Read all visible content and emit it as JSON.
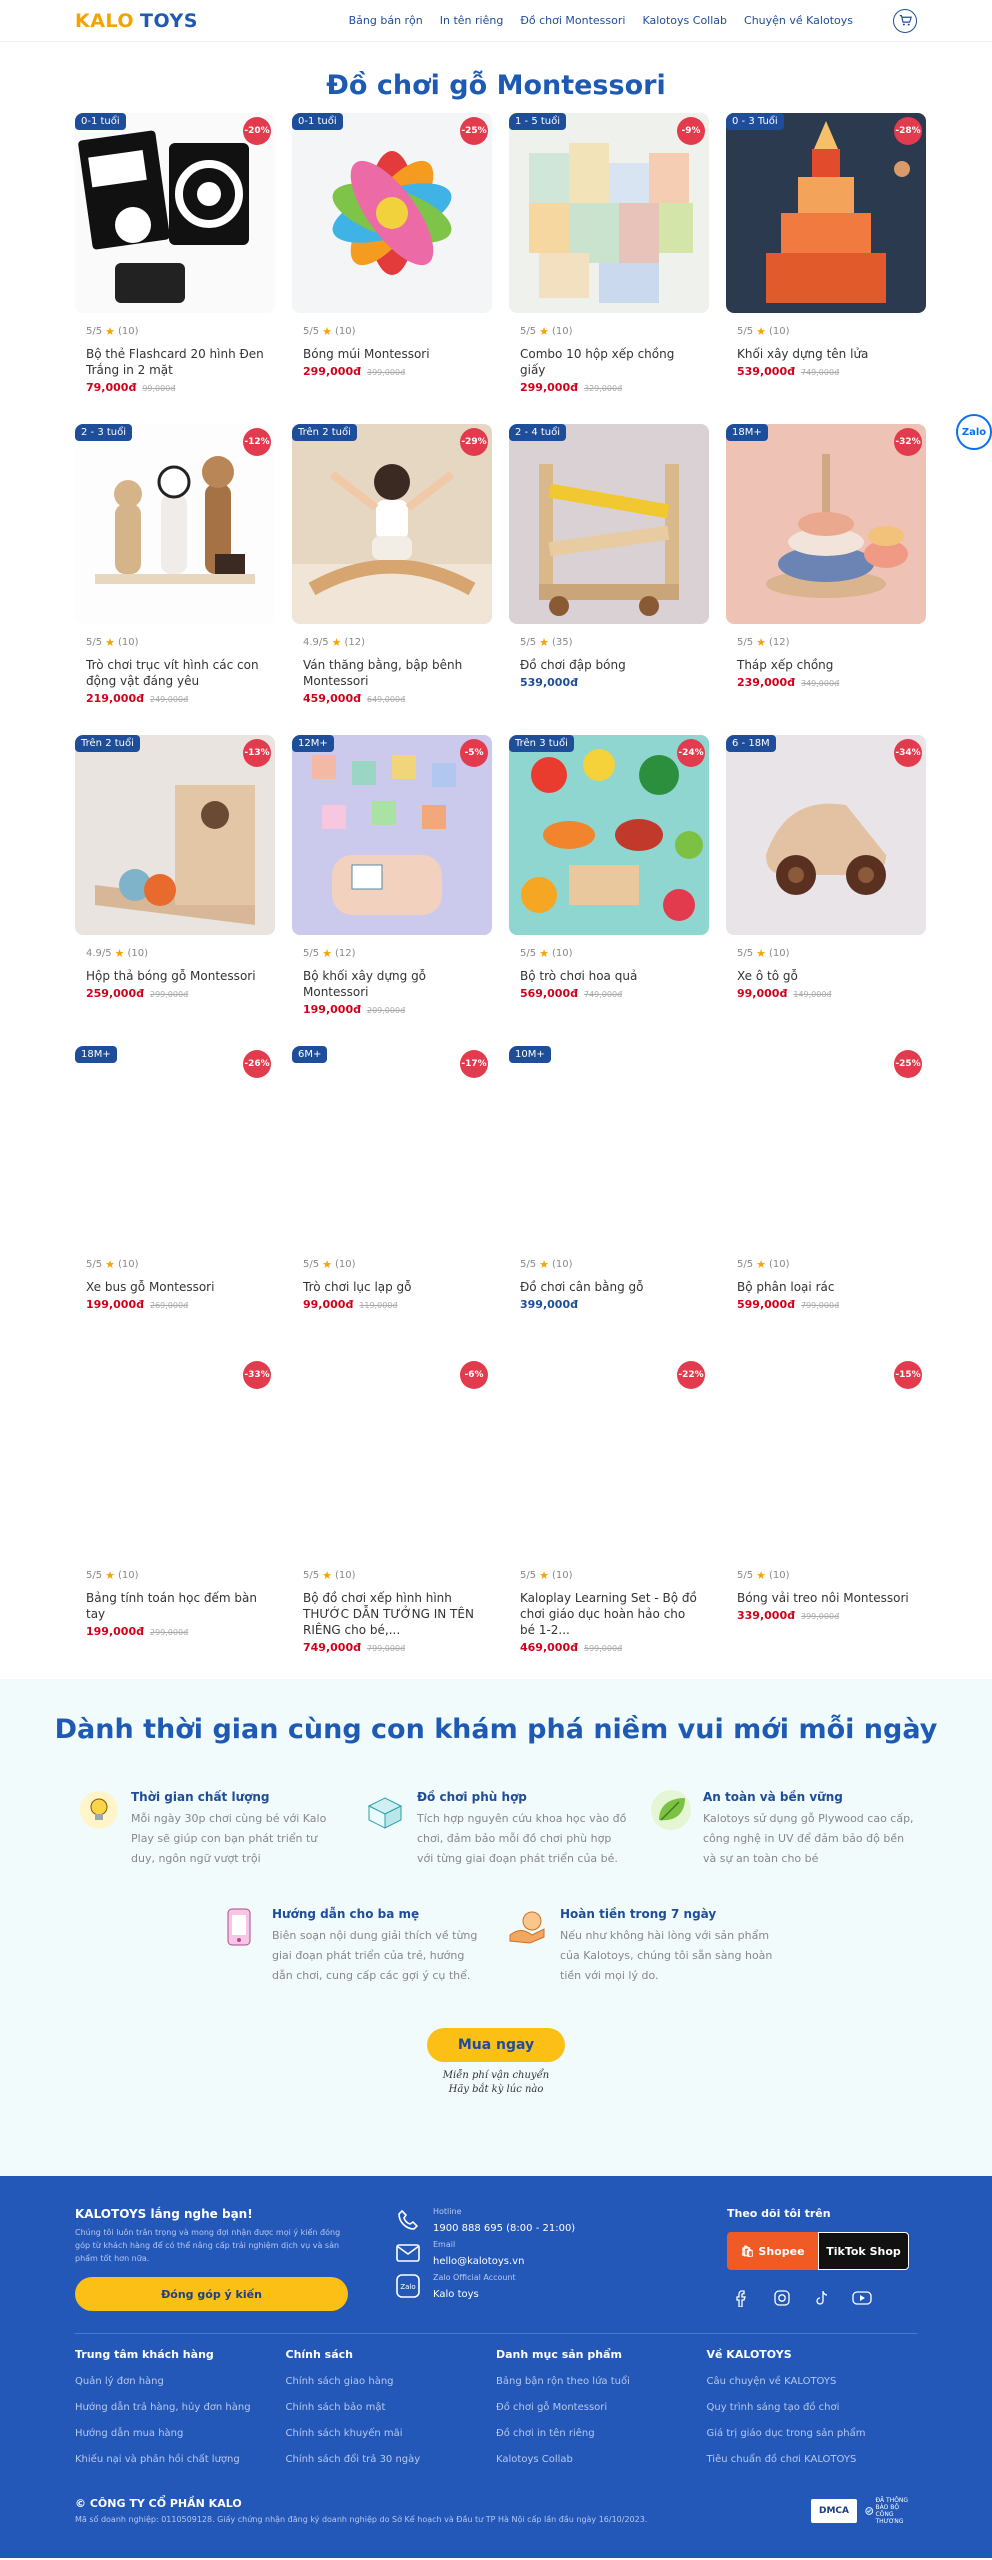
{
  "header": {
    "logo_left": "KALO",
    "logo_right": "TOYS",
    "nav": [
      "Bảng bán rộn",
      "In tên riêng",
      "Đồ chơi Montessori",
      "Kalotoys Collab",
      "Chuyện về Kalotoys"
    ]
  },
  "section_title": "Đồ chơi gỗ Montessori",
  "products": [
    {
      "age": "0-1 tuổi",
      "discount": "-20%",
      "rating": "5/5",
      "reviews": "(10)",
      "name": "Bộ thẻ Flashcard 20 hình Đen Trắng in 2 mặt",
      "price": "79,000đ",
      "old": "99,000đ"
    },
    {
      "age": "0-1 tuổi",
      "discount": "-25%",
      "rating": "5/5",
      "reviews": "(10)",
      "name": "Bóng múi Montessori",
      "price": "299,000đ",
      "old": "399,000đ"
    },
    {
      "age": "1 - 5 tuổi",
      "discount": "-9%",
      "rating": "5/5",
      "reviews": "(10)",
      "name": "Combo 10 hộp xếp chồng giấy",
      "price": "299,000đ",
      "old": "329,000đ"
    },
    {
      "age": "0 - 3 Tuổi",
      "discount": "-28%",
      "rating": "5/5",
      "reviews": "(10)",
      "name": "Khối xây dựng tên lửa",
      "price": "539,000đ",
      "old": "749,000đ"
    },
    {
      "age": "2 - 3 tuổi",
      "discount": "-12%",
      "rating": "5/5",
      "reviews": "(10)",
      "name": "Trò chơi trục vít hình các con động vật đáng yêu",
      "price": "219,000đ",
      "old": "249,000đ"
    },
    {
      "age": "Trên 2 tuổi",
      "discount": "-29%",
      "rating": "4.9/5",
      "reviews": "(12)",
      "name": "Ván thăng bằng, bập bênh Montessori",
      "price": "459,000đ",
      "old": "649,000đ"
    },
    {
      "age": "2 - 4 tuổi",
      "discount": "",
      "rating": "5/5",
      "reviews": "(35)",
      "name": "Đồ chơi đập bóng",
      "price": "539,000đ",
      "old": ""
    },
    {
      "age": "18M+",
      "discount": "-32%",
      "rating": "5/5",
      "reviews": "(12)",
      "name": "Tháp xếp chồng",
      "price": "239,000đ",
      "old": "349,000đ"
    },
    {
      "age": "Trên 2 tuổi",
      "discount": "-13%",
      "rating": "4.9/5",
      "reviews": "(10)",
      "name": "Hộp thả bóng gỗ Montessori",
      "price": "259,000đ",
      "old": "299,000đ"
    },
    {
      "age": "12M+",
      "discount": "-5%",
      "rating": "5/5",
      "reviews": "(12)",
      "name": "Bộ khối xây dựng gỗ Montessori",
      "price": "199,000đ",
      "old": "209,000đ"
    },
    {
      "age": "Trên 3 tuổi",
      "discount": "-24%",
      "rating": "5/5",
      "reviews": "(10)",
      "name": "Bộ trò chơi hoa quả",
      "price": "569,000đ",
      "old": "749,000đ"
    },
    {
      "age": "6 - 18M",
      "discount": "-34%",
      "rating": "5/5",
      "reviews": "(10)",
      "name": "Xe ô tô gỗ",
      "price": "99,000đ",
      "old": "149,000đ"
    },
    {
      "age": "18M+",
      "discount": "-26%",
      "rating": "5/5",
      "reviews": "(10)",
      "name": "Xe bus gỗ Montessori",
      "price": "199,000đ",
      "old": "269,000đ"
    },
    {
      "age": "6M+",
      "discount": "-17%",
      "rating": "5/5",
      "reviews": "(10)",
      "name": "Trò chơi lục lạp gỗ",
      "price": "99,000đ",
      "old": "119,000đ"
    },
    {
      "age": "10M+",
      "discount": "",
      "rating": "5/5",
      "reviews": "(10)",
      "name": "Đồ chơi cân bằng gỗ",
      "price": "399,000đ",
      "old": ""
    },
    {
      "age": "",
      "discount": "-25%",
      "rating": "5/5",
      "reviews": "(10)",
      "name": "Bộ phân loại rác",
      "price": "599,000đ",
      "old": "799,000đ"
    },
    {
      "age": "",
      "discount": "-33%",
      "rating": "5/5",
      "reviews": "(10)",
      "name": "Bảng tính toán học đếm bàn tay",
      "price": "199,000đ",
      "old": "299,000đ"
    },
    {
      "age": "",
      "discount": "-6%",
      "rating": "5/5",
      "reviews": "(10)",
      "name": "Bộ đồ chơi xếp hình hình THƯỚC DẪN TƯỞNG IN TÊN RIÊNG cho bé,...",
      "price": "749,000đ",
      "old": "799,000đ"
    },
    {
      "age": "",
      "discount": "-22%",
      "rating": "5/5",
      "reviews": "(10)",
      "name": "Kaloplay Learning Set - Bộ đồ chơi giáo dục hoàn hảo cho bé 1-2...",
      "price": "469,000đ",
      "old": "599,000đ"
    },
    {
      "age": "",
      "discount": "-15%",
      "rating": "5/5",
      "reviews": "(10)",
      "name": "Bóng vải treo nôi Montessori",
      "price": "339,000đ",
      "old": "399,000đ"
    }
  ],
  "benefits": {
    "title": "Dành thời gian cùng con khám phá niềm vui mới mỗi ngày",
    "items": [
      {
        "icon": "lightbulb-icon",
        "title": "Thời gian chất lượng",
        "text": "Mỗi ngày 30p chơi cùng bé với Kalo Play sẽ giúp con bạn phát triển tư duy, ngôn ngữ vượt trội"
      },
      {
        "icon": "toy-box-icon",
        "title": "Đồ chơi phù hợp",
        "text": "Tích hợp nguyên cứu khoa học vào đồ chơi, đảm bảo mỗi đồ chơi phù hợp với từng giai đoạn phát triển của bé."
      },
      {
        "icon": "leaf-icon",
        "title": "An toàn và bền vững",
        "text": "Kalotoys sử dụng gỗ Plywood cao cấp, công nghệ in UV để đảm bảo độ bền và sự an toàn cho bé"
      },
      {
        "icon": "phone-guide-icon",
        "title": "Hướng dẫn cho ba mẹ",
        "text": "Biên soạn nội dung giải thích về từng giai đoạn phát triển của trẻ, hướng dẫn chơi, cung cấp các gợi ý cụ thể."
      },
      {
        "icon": "refund-hand-icon",
        "title": "Hoàn tiền trong 7 ngày",
        "text": "Nếu như không hài lòng với sản phẩm của Kalotoys, chúng tôi sẵn sàng hoàn tiền với mọi lý do."
      }
    ],
    "cta": "Mua ngay",
    "ship_line1": "Miễn phí vận chuyển",
    "ship_line2": "Hãy bắt kỳ lúc nào"
  },
  "footer": {
    "listen_title": "KALOTOYS lắng nghe bạn!",
    "listen_text": "Chúng tôi luôn trân trọng và mong đợi nhận được mọi ý kiến đóng góp từ khách hàng để có thể nâng cấp trải nghiệm dịch vụ và sản phẩm tốt hơn nữa.",
    "feedback_button": "Đóng góp ý kiến",
    "hotline_label": "Hotline",
    "hotline": "1900 888 695 (8:00 - 21:00)",
    "email_label": "Email",
    "email": "hello@kalotoys.vn",
    "zalo_label": "Zalo Official Account",
    "zalo": "Kalo toys",
    "follow_title": "Theo dõi tôi trên",
    "shopee": "Shopee",
    "tiktok": "TikTok Shop",
    "columns": [
      {
        "title": "Trung tâm khách hàng",
        "links": [
          "Quản lý đơn hàng",
          "Hướng dẫn trả hàng, hủy đơn hàng",
          "Hướng dẫn mua hàng",
          "Khiếu nại và phản hồi chất lượng"
        ]
      },
      {
        "title": "Chính sách",
        "links": [
          "Chính sách giao hàng",
          "Chính sách bảo mật",
          "Chính sách khuyến mãi",
          "Chính sách đổi trả 30 ngày"
        ]
      },
      {
        "title": "Danh mục sản phẩm",
        "links": [
          "Bảng bận rộn theo lứa tuổi",
          "Đồ chơi gỗ Montessori",
          "Đồ chơi in tên riêng",
          "Kalotoys Collab"
        ]
      },
      {
        "title": "Về KALOTOYS",
        "links": [
          "Câu chuyện về KALOTOYS",
          "Quy trình sáng tạo đồ chơi",
          "Giá trị giáo dục trong sản phẩm",
          "Tiêu chuẩn đồ chơi KALOTOYS"
        ]
      }
    ],
    "company": "© CÔNG TY CỔ PHẦN KALO",
    "company_info": "Mã số doanh nghiệp: 0110509128. Giấy chứng nhận đăng ký doanh nghiệp do Sở Kế hoạch và Đầu tư TP Hà Nội cấp lần đầu ngày 16/10/2023.",
    "dmca": "DMCA",
    "bct": "ĐÃ THÔNG BÁO BỘ CÔNG THƯƠNG"
  },
  "zalo_float": "Zalo"
}
